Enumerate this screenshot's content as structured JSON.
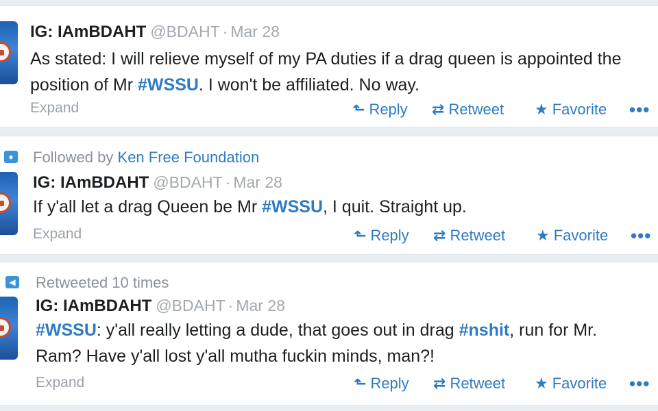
{
  "tweets": [
    {
      "context": null,
      "author": {
        "name": "IG: IAmBDAHT",
        "handle": "@BDAHT",
        "sep": "·",
        "date": "Mar 28"
      },
      "text": {
        "line1": "As stated: I will relieve myself of my PA duties if a drag queen is appointed the",
        "line2_before": "position of Mr ",
        "line2_tag": "#WSSU",
        "line2_after": ". I won't be affiliated. No way."
      },
      "expand": "Expand",
      "actions": {
        "reply": "Reply",
        "retweet": "Retweet",
        "favorite": "Favorite",
        "more": "•••"
      }
    },
    {
      "context": {
        "icon": "person-icon",
        "prefix": "Followed by ",
        "link": "Ken Free Foundation"
      },
      "author": {
        "name": "IG: IAmBDAHT",
        "handle": "@BDAHT",
        "sep": "·",
        "date": "Mar 28"
      },
      "text": {
        "before": "If y'all let a drag Queen be Mr ",
        "tag": "#WSSU",
        "after": ", I quit. Straight up."
      },
      "expand": "Expand",
      "actions": {
        "reply": "Reply",
        "retweet": "Retweet",
        "favorite": "Favorite",
        "more": "•••"
      }
    },
    {
      "context": {
        "icon": "megaphone-icon",
        "text": "Retweeted 10 times"
      },
      "author": {
        "name": "IG: IAmBDAHT",
        "handle": "@BDAHT",
        "sep": "·",
        "date": "Mar 28"
      },
      "text": {
        "tag1": "#WSSU",
        "mid": ": y'all really letting a dude, that goes out in drag ",
        "tag2": "#nshit",
        "end": ", run for Mr.",
        "line2": "Ram? Have y'all lost y'all mutha fuckin minds, man?!"
      },
      "expand": "Expand",
      "actions": {
        "reply": "Reply",
        "retweet": "Retweet",
        "favorite": "Favorite",
        "more": "•••"
      }
    }
  ],
  "icons": {
    "reply": "reply-arrow-icon",
    "retweet": "retweet-icon",
    "favorite": "star-icon",
    "more": "more-dots-icon"
  },
  "colors": {
    "link": "#2d7bc4",
    "muted": "#a2a8ae",
    "text": "#1c1f22",
    "background": "#e9eef2"
  }
}
